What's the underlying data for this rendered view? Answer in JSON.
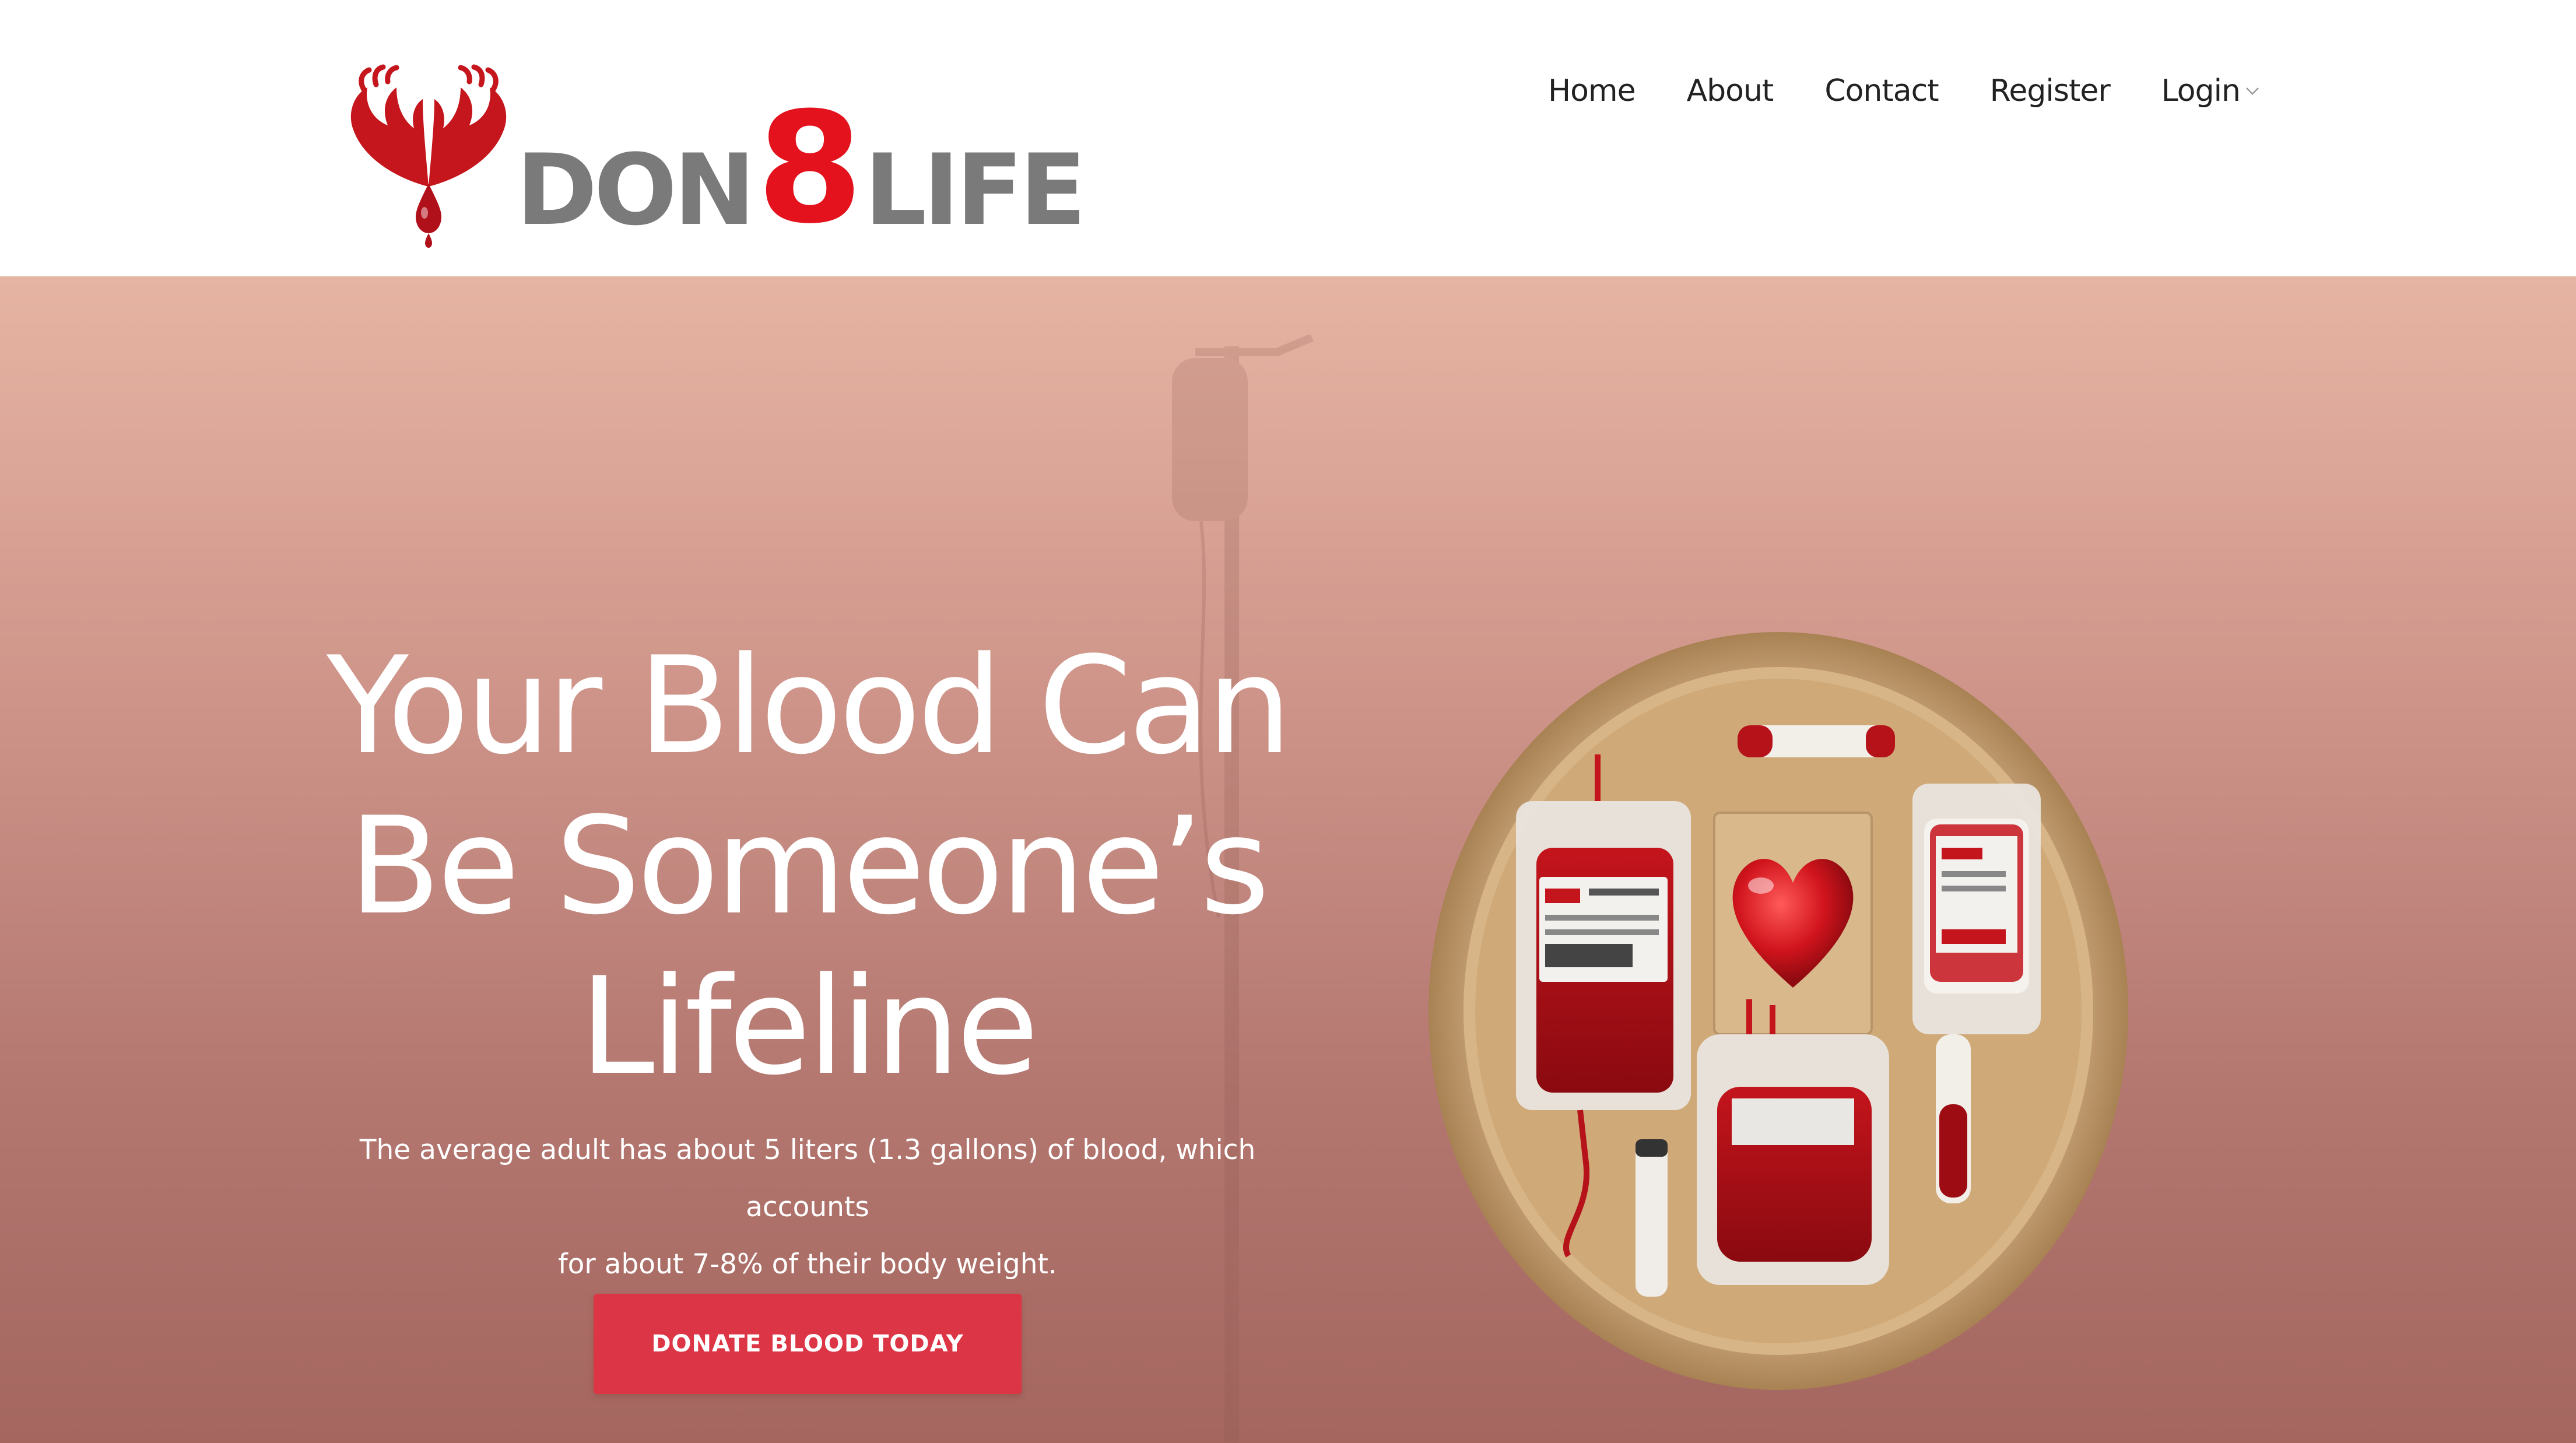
{
  "brand": {
    "name_part1": "DON",
    "name_part2": "8",
    "name_part3": "LIFE",
    "primary_color": "#e3121d",
    "text_color": "#7a7a7a"
  },
  "nav": {
    "items": [
      {
        "label": "Home"
      },
      {
        "label": "About"
      },
      {
        "label": "Contact"
      },
      {
        "label": "Register"
      },
      {
        "label": "Login",
        "has_dropdown": true
      }
    ]
  },
  "hero": {
    "title_line1": "Your Blood Can",
    "title_line2": "Be Someone’s",
    "title_line3": "Lifeline",
    "subtitle_line1": "The average adult has about 5 liters (1.3 gallons) of blood, which accounts",
    "subtitle_line2": "for about 7-8% of their body weight.",
    "cta_label": "DONATE BLOOD TODAY",
    "cta_color": "#dc3545",
    "background_top": "#e6b4a3",
    "background_bottom": "#a4665f"
  },
  "icons": {
    "logo_mark": "hands-blood-drop-icon",
    "login_dropdown": "chevron-down-icon"
  }
}
